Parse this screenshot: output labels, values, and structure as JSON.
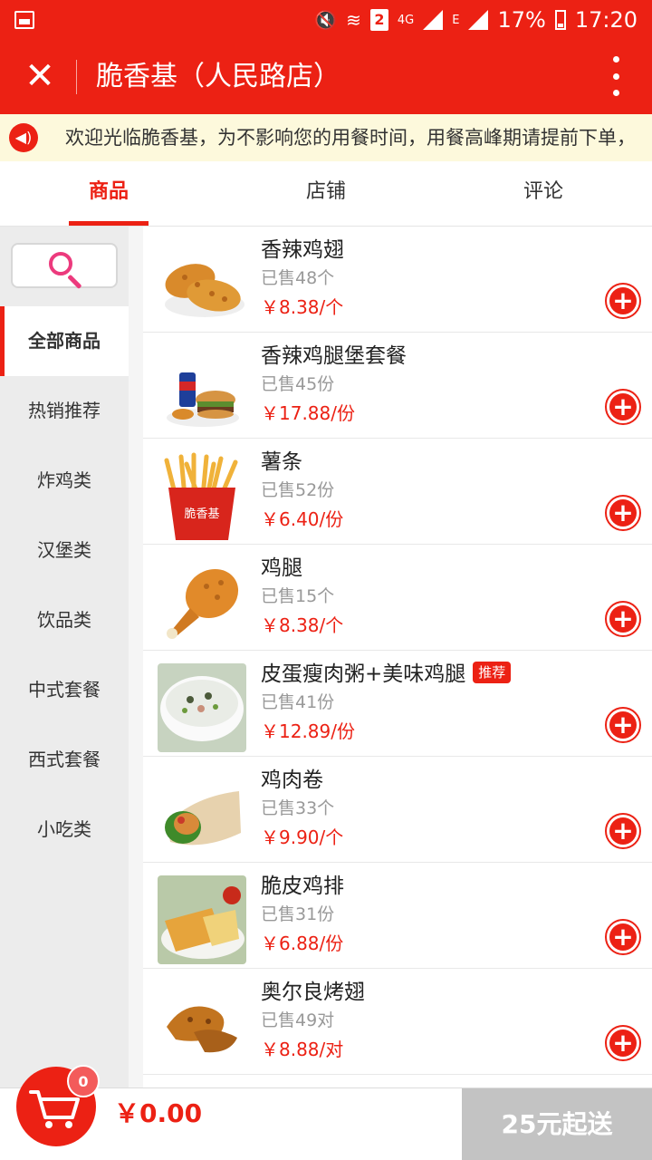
{
  "status_bar": {
    "network": "4G",
    "sim_slot": "2",
    "edge": "E",
    "battery": "17%",
    "time": "17:20"
  },
  "header": {
    "title": "脆香基（人民路店）"
  },
  "notice": {
    "text": "欢迎光临脆香基，为不影响您的用餐时间，用餐高峰期请提前下单，"
  },
  "tabs": [
    {
      "label": "商品",
      "active": true
    },
    {
      "label": "店铺",
      "active": false
    },
    {
      "label": "评论",
      "active": false
    }
  ],
  "categories": [
    {
      "label": "全部商品",
      "active": true
    },
    {
      "label": "热销推荐"
    },
    {
      "label": "炸鸡类"
    },
    {
      "label": "汉堡类"
    },
    {
      "label": "饮品类"
    },
    {
      "label": "中式套餐"
    },
    {
      "label": "西式套餐"
    },
    {
      "label": "小吃类"
    }
  ],
  "products": [
    {
      "name": "香辣鸡翅",
      "sold": "已售48个",
      "price": "￥8.38/个",
      "image": "chicken-wings"
    },
    {
      "name": "香辣鸡腿堡套餐",
      "sold": "已售45份",
      "price": "￥17.88/份",
      "image": "burger-combo"
    },
    {
      "name": "薯条",
      "sold": "已售52份",
      "price": "￥6.40/份",
      "image": "fries",
      "image_text": "脆香基"
    },
    {
      "name": "鸡腿",
      "sold": "已售15个",
      "price": "￥8.38/个",
      "image": "drumstick"
    },
    {
      "name": "皮蛋瘦肉粥+美味鸡腿",
      "badge": "推荐",
      "sold": "已售41份",
      "price": "￥12.89/份",
      "image": "congee"
    },
    {
      "name": "鸡肉卷",
      "sold": "已售33个",
      "price": "￥9.90/个",
      "image": "chicken-wrap"
    },
    {
      "name": "脆皮鸡排",
      "sold": "已售31份",
      "price": "￥6.88/份",
      "image": "chicken-cutlet"
    },
    {
      "name": "奥尔良烤翅",
      "sold": "已售49对",
      "price": "￥8.88/对",
      "image": "roast-wings"
    }
  ],
  "cart": {
    "count": "0",
    "total": "￥0.00",
    "min_order_label": "25元起送"
  },
  "colors": {
    "brand": "#ec2114",
    "notice_bg": "#fdf9dc",
    "disabled": "#c3c3c3"
  }
}
